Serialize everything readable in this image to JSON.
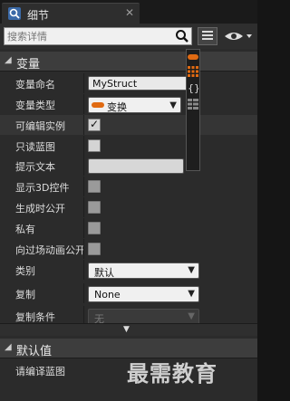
{
  "tab": {
    "title": "细节"
  },
  "search": {
    "placeholder": "搜索详情"
  },
  "categories": {
    "variable": "变量",
    "default_value": "默认值"
  },
  "fields": {
    "var_name_label": "变量命名",
    "var_name_value": "MyStruct",
    "var_type_label": "变量类型",
    "var_type_value": "变换",
    "editable_label": "可编辑实例",
    "readonly_label": "只读蓝图",
    "tooltip_label": "提示文本",
    "show3d_label": "显示3D控件",
    "expose_spawn_label": "生成时公开",
    "private_label": "私有",
    "expose_cine_label": "向过场动画公开",
    "category_label": "类别",
    "category_value": "默认",
    "replication_label": "复制",
    "replication_value": "None",
    "rep_condition_label": "复制条件",
    "rep_condition_value": "无"
  },
  "default_section": {
    "compile_msg": "请编译蓝图"
  },
  "watermark": "最需教育",
  "colors": {
    "struct_orange": "#e06a12",
    "panel": "#2b2b2b",
    "header": "#3d3d3d"
  },
  "checkbox_states": {
    "editable": true,
    "readonly": false,
    "show3d": false,
    "expose_spawn": false,
    "private": false,
    "expose_cine": false
  }
}
